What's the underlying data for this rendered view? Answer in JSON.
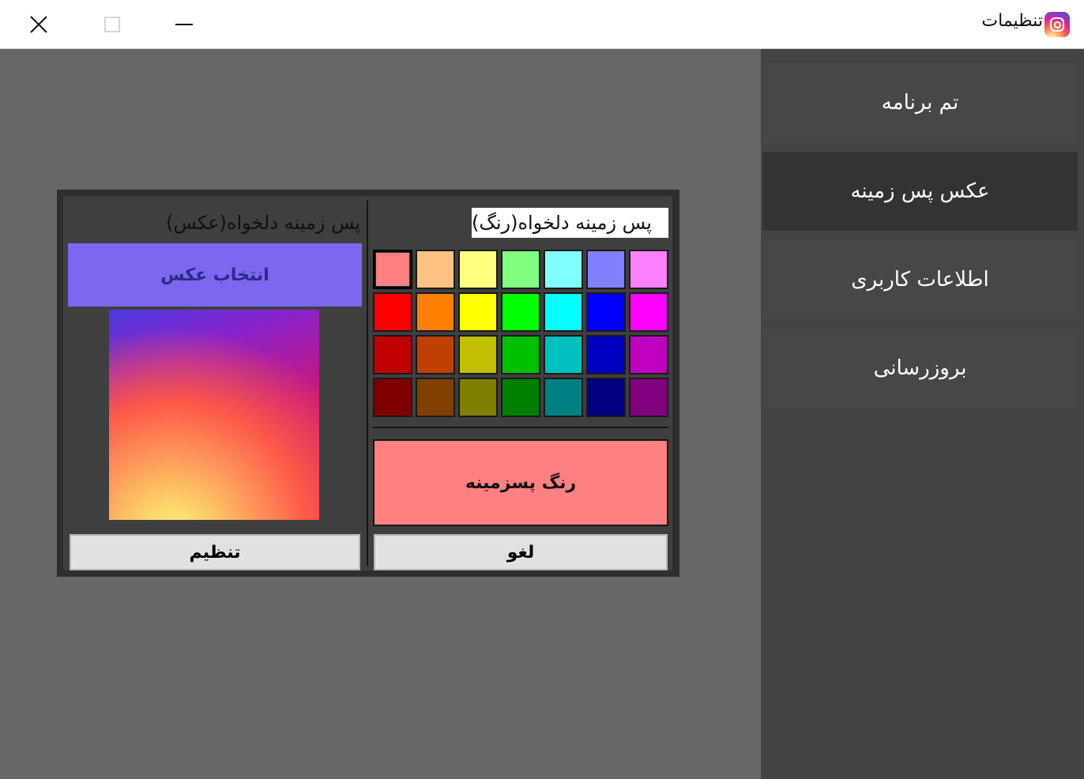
{
  "window": {
    "title": "تنظیمات",
    "icon": "instagram-icon",
    "controls": {
      "close_icon": "close-icon",
      "maximize_icon": "maximize-icon",
      "minimize_icon": "minimize-icon"
    }
  },
  "sidebar": {
    "active_index": 1,
    "items": [
      {
        "label": "تم برنامه"
      },
      {
        "label": "عکس پس زمینه"
      },
      {
        "label": "اطلاعات کاربری"
      },
      {
        "label": "بروزرسانی"
      }
    ]
  },
  "color_section": {
    "title": "پس زمینه دلخواه(رنگ)",
    "selected_index": 0,
    "palette": [
      "#ff8080",
      "#ffc080",
      "#ffff80",
      "#80ff80",
      "#80ffff",
      "#8080ff",
      "#ff80ff",
      "#ff0000",
      "#ff8000",
      "#ffff00",
      "#00ff00",
      "#00ffff",
      "#0000ff",
      "#ff00ff",
      "#c00000",
      "#c04000",
      "#c0c000",
      "#00c000",
      "#00c0c0",
      "#0000c0",
      "#c000c0",
      "#800000",
      "#804000",
      "#808000",
      "#008000",
      "#008080",
      "#000080",
      "#800080"
    ],
    "preview_label": "رنگ پسزمینه",
    "preview_color": "#ff8080",
    "cancel_label": "لغو"
  },
  "image_section": {
    "title": "پس زمینه دلخواه(عکس)",
    "pick_label": "انتخاب عکس",
    "pick_color": "#7b68ee",
    "apply_label": "تنظیم"
  }
}
